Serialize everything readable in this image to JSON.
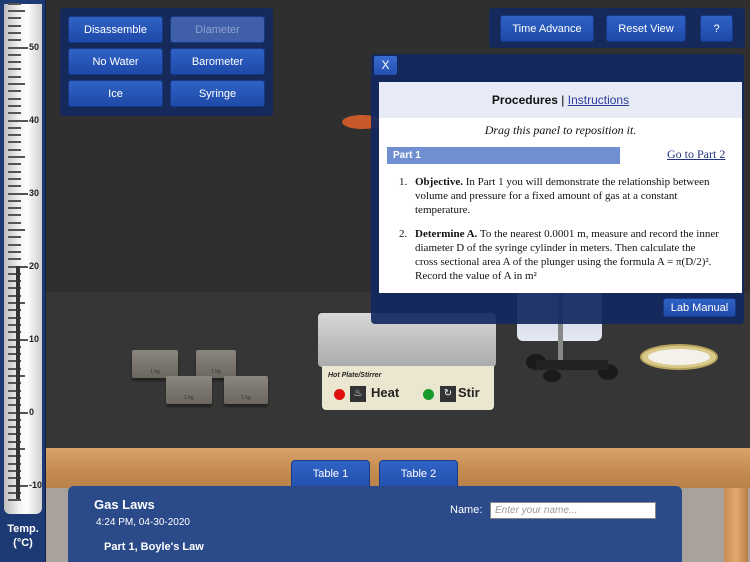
{
  "thermometer": {
    "label_line1": "Temp.",
    "label_line2": "(°C)",
    "unit": "°C",
    "ticks": [
      "50",
      "40",
      "30",
      "20",
      "10",
      "0",
      "-10"
    ],
    "reading_approx": 20
  },
  "controls_left": {
    "buttons": [
      {
        "label": "Disassemble",
        "enabled": true
      },
      {
        "label": "Diameter",
        "enabled": false
      },
      {
        "label": "No Water",
        "enabled": true
      },
      {
        "label": "Barometer",
        "enabled": true
      },
      {
        "label": "Ice",
        "enabled": true
      },
      {
        "label": "Syringe",
        "enabled": true
      }
    ]
  },
  "controls_right": {
    "time_advance": "Time Advance",
    "reset_view": "Reset View",
    "help": "?"
  },
  "procedures": {
    "close": "X",
    "title": "Procedures",
    "separator": "|",
    "instructions_link": "Instructions",
    "drag_note": "Drag this panel to reposition it.",
    "part_label": "Part 1",
    "go_to_part": "Go to Part 2",
    "items": [
      {
        "num": "1.",
        "lead": "Objective.",
        "text": " In Part 1 you will demonstrate the relationship between volume and pressure for a fixed amount of gas at a constant temperature."
      },
      {
        "num": "2.",
        "lead": "Determine A.",
        "text": " To the nearest 0.0001 m, measure and record the inner diameter D of the syringe cylinder in meters. Then calculate the cross sectional area A of the plunger using the formula A = π(D/2)². Record the value of A in m²"
      }
    ],
    "lab_manual": "Lab Manual"
  },
  "equipment": {
    "weights": [
      "1 kg",
      "1 kg",
      "1 kg",
      "1 kg"
    ],
    "hotplate_title": "Hot Plate/Stirrer",
    "heat_label": "Heat",
    "stir_label": "Stir",
    "heat_led_color": "#e01010",
    "stir_led_color": "#1a9a2a"
  },
  "bottom": {
    "tabs": [
      "Table 1",
      "Table 2"
    ],
    "title": "Gas Laws",
    "datetime": "4:24 PM, 04-30-2020",
    "part": "Part 1, Boyle's Law",
    "name_label": "Name:",
    "name_placeholder": "Enter your name...",
    "name_value": ""
  }
}
